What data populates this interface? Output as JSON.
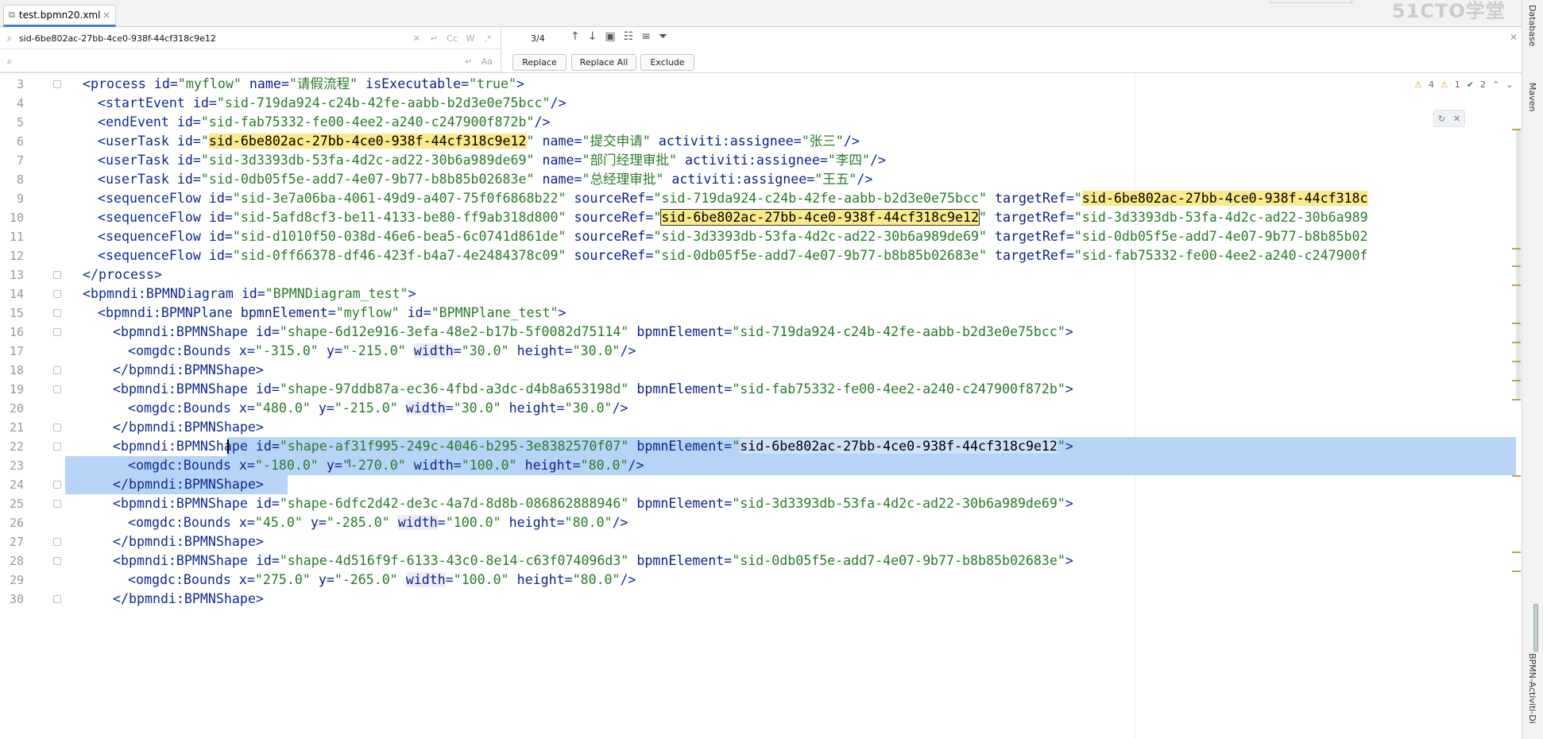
{
  "tab": {
    "icon": "xml-file-icon",
    "title": "test.bpmn20.xml",
    "close": "×"
  },
  "watermark": "51CTO学堂",
  "find": {
    "search_value": "sid-6be802ac-27bb-4ce0-938f-44cf318c9e12",
    "replace_value": "",
    "opt_case": "Cc",
    "opt_words": "W",
    "opt_regex": ".*",
    "opt_preserve": "Aa",
    "match_count": "3/4",
    "buttons": {
      "replace": "Replace",
      "replace_all": "Replace All",
      "exclude": "Exclude"
    }
  },
  "inspection": {
    "warnings": "4",
    "weak": "1",
    "typos": "2"
  },
  "side_tools": {
    "database": "Database",
    "maven": "Maven",
    "bpmn": "BPMN-Activiti-Di"
  },
  "lines": [
    {
      "n": "3",
      "indent": 1,
      "tokens": [
        [
          "tag",
          "<process "
        ],
        [
          "attr",
          "id"
        ],
        [
          "tag",
          "="
        ],
        [
          "val",
          "\"my"
        ],
        [
          "val",
          "flow\""
        ],
        [
          "tag",
          " "
        ],
        [
          "attr",
          "name"
        ],
        [
          "tag",
          "="
        ],
        [
          "val",
          "\"请假流程\""
        ],
        [
          "tag",
          " "
        ],
        [
          "attr",
          "isExecutable"
        ],
        [
          "tag",
          "="
        ],
        [
          "val",
          "\"true\""
        ],
        [
          "tag",
          ">"
        ]
      ]
    },
    {
      "n": "4",
      "indent": 2,
      "tokens": [
        [
          "tag",
          "<startEvent "
        ],
        [
          "attr",
          "id"
        ],
        [
          "tag",
          "="
        ],
        [
          "val",
          "\"sid-719da924-c24b-42fe-aabb-b2d3e0e75bcc\""
        ],
        [
          "tag",
          "/>"
        ]
      ]
    },
    {
      "n": "5",
      "indent": 2,
      "tokens": [
        [
          "tag",
          "<endEvent "
        ],
        [
          "attr",
          "id"
        ],
        [
          "tag",
          "="
        ],
        [
          "val",
          "\"sid-fab75332-fe00-4ee2-a240-c247900f872b\""
        ],
        [
          "tag",
          "/>"
        ]
      ]
    },
    {
      "n": "6",
      "indent": 2,
      "tokens": [
        [
          "tag",
          "<userTask "
        ],
        [
          "attr",
          "id"
        ],
        [
          "tag",
          "="
        ],
        [
          "val",
          "\""
        ],
        [
          "hl",
          "sid-6be802ac-27bb-4ce0-938f-44cf318c9e12"
        ],
        [
          "val",
          "\""
        ],
        [
          "tag",
          " "
        ],
        [
          "attr",
          "name"
        ],
        [
          "tag",
          "="
        ],
        [
          "val",
          "\"提交申请\""
        ],
        [
          "tag",
          " "
        ],
        [
          "attr",
          "activiti:assignee"
        ],
        [
          "tag",
          "="
        ],
        [
          "val",
          "\"张三\""
        ],
        [
          "tag",
          "/>"
        ]
      ]
    },
    {
      "n": "7",
      "indent": 2,
      "tokens": [
        [
          "tag",
          "<userTask "
        ],
        [
          "attr",
          "id"
        ],
        [
          "tag",
          "="
        ],
        [
          "val",
          "\"sid-3d3393db-53fa-4d2c-ad22-30b6a989de69\""
        ],
        [
          "tag",
          " "
        ],
        [
          "attr",
          "name"
        ],
        [
          "tag",
          "="
        ],
        [
          "val",
          "\"部门经理审批\""
        ],
        [
          "tag",
          " "
        ],
        [
          "attr",
          "activiti:assignee"
        ],
        [
          "tag",
          "="
        ],
        [
          "val",
          "\"李四\""
        ],
        [
          "tag",
          "/>"
        ]
      ]
    },
    {
      "n": "8",
      "indent": 2,
      "tokens": [
        [
          "tag",
          "<userTask "
        ],
        [
          "attr",
          "id"
        ],
        [
          "tag",
          "="
        ],
        [
          "val",
          "\"sid-0db05f5e-add7-4e07-9b77-b8b85b02683e\""
        ],
        [
          "tag",
          " "
        ],
        [
          "attr",
          "name"
        ],
        [
          "tag",
          "="
        ],
        [
          "val",
          "\"总经理审批\""
        ],
        [
          "tag",
          " "
        ],
        [
          "attr",
          "activiti:assignee"
        ],
        [
          "tag",
          "="
        ],
        [
          "val",
          "\"王五\""
        ],
        [
          "tag",
          "/>"
        ]
      ]
    },
    {
      "n": "9",
      "indent": 2,
      "tokens": [
        [
          "tag",
          "<sequenceFlow "
        ],
        [
          "attr",
          "id"
        ],
        [
          "tag",
          "="
        ],
        [
          "val",
          "\"sid-3e7a06ba-4061-49d9-a407-75f0f6868b22\""
        ],
        [
          "tag",
          " "
        ],
        [
          "attr",
          "sourceRef"
        ],
        [
          "tag",
          "="
        ],
        [
          "val",
          "\"sid-719da924-c24b-42fe-aabb-b2d3e0e75bcc\""
        ],
        [
          "tag",
          " "
        ],
        [
          "attr",
          "targetRef"
        ],
        [
          "tag",
          "="
        ],
        [
          "val",
          "\""
        ],
        [
          "hl",
          "sid-6be802ac-27bb-4ce0-938f-44cf318c"
        ]
      ]
    },
    {
      "n": "10",
      "indent": 2,
      "tokens": [
        [
          "tag",
          "<sequenceFlow "
        ],
        [
          "attr",
          "id"
        ],
        [
          "tag",
          "="
        ],
        [
          "val",
          "\"sid-5afd8cf3-be11-4133-be80-ff9ab318d800\""
        ],
        [
          "tag",
          " "
        ],
        [
          "attr",
          "sourceRef"
        ],
        [
          "tag",
          "="
        ],
        [
          "val",
          "\""
        ],
        [
          "hlc",
          "sid-6be802ac-27bb-4ce0-938f-44cf318c9e12"
        ],
        [
          "val",
          "\""
        ],
        [
          "tag",
          " "
        ],
        [
          "attr",
          "targetRef"
        ],
        [
          "tag",
          "="
        ],
        [
          "val",
          "\"sid-3d3393db-53fa-4d2c-ad22-30b6a989"
        ]
      ]
    },
    {
      "n": "11",
      "indent": 2,
      "tokens": [
        [
          "tag",
          "<sequenceFlow "
        ],
        [
          "attr",
          "id"
        ],
        [
          "tag",
          "="
        ],
        [
          "val",
          "\"sid-d1010f50-038d-46e6-bea5-6c0741d861de\""
        ],
        [
          "tag",
          " "
        ],
        [
          "attr",
          "sourceRef"
        ],
        [
          "tag",
          "="
        ],
        [
          "val",
          "\"sid-3d3393db-53fa-4d2c-ad22-30b6a989de69\""
        ],
        [
          "tag",
          " "
        ],
        [
          "attr",
          "targetRef"
        ],
        [
          "tag",
          "="
        ],
        [
          "val",
          "\"sid-0db05f5e-add7-4e07-9b77-b8b85b02"
        ]
      ]
    },
    {
      "n": "12",
      "indent": 2,
      "tokens": [
        [
          "tag",
          "<sequenceFlow "
        ],
        [
          "attr",
          "id"
        ],
        [
          "tag",
          "="
        ],
        [
          "val",
          "\"sid-0ff66378-df46-423f-b4a7-4e2484378c09\""
        ],
        [
          "tag",
          " "
        ],
        [
          "attr",
          "sourceRef"
        ],
        [
          "tag",
          "="
        ],
        [
          "val",
          "\"sid-0db05f5e-add7-4e07-9b77-b8b85b02683e\""
        ],
        [
          "tag",
          " "
        ],
        [
          "attr",
          "targetRef"
        ],
        [
          "tag",
          "="
        ],
        [
          "val",
          "\"sid-fab75332-fe00-4ee2-a240-c247900f"
        ]
      ]
    },
    {
      "n": "13",
      "indent": 1,
      "tokens": [
        [
          "tag",
          "</process>"
        ]
      ]
    },
    {
      "n": "14",
      "indent": 1,
      "tokens": [
        [
          "tag",
          "<bpmndi:BPMNDiagram "
        ],
        [
          "attr",
          "id"
        ],
        [
          "tag",
          "="
        ],
        [
          "val",
          "\"BPMNDiagram_test\""
        ],
        [
          "tag",
          ">"
        ]
      ]
    },
    {
      "n": "15",
      "indent": 2,
      "tokens": [
        [
          "tag",
          "<bpmndi:BPMNPlane "
        ],
        [
          "attr",
          "bpmnElement"
        ],
        [
          "tag",
          "="
        ],
        [
          "val",
          "\"my"
        ],
        [
          "val",
          "flow\""
        ],
        [
          "tag",
          " "
        ],
        [
          "attr",
          "id"
        ],
        [
          "tag",
          "="
        ],
        [
          "val",
          "\"BPMNPlane_test\""
        ],
        [
          "tag",
          ">"
        ]
      ]
    },
    {
      "n": "16",
      "indent": 3,
      "tokens": [
        [
          "tag",
          "<bpmndi:BPMNShape "
        ],
        [
          "attr",
          "id"
        ],
        [
          "tag",
          "="
        ],
        [
          "val",
          "\"shape-6d12e916-3efa-48e2-b17b-5f0082d75114\""
        ],
        [
          "tag",
          " "
        ],
        [
          "attr",
          "bpmnElement"
        ],
        [
          "tag",
          "="
        ],
        [
          "val",
          "\"sid-719da924-c24b-42fe-aabb-b2d3e0e75bcc\""
        ],
        [
          "tag",
          ">"
        ]
      ]
    },
    {
      "n": "17",
      "indent": 4,
      "tokens": [
        [
          "tag",
          "<omgdc:Bounds "
        ],
        [
          "attr",
          "x"
        ],
        [
          "tag",
          "="
        ],
        [
          "val",
          "\"-315.0\""
        ],
        [
          "tag",
          " "
        ],
        [
          "attr",
          "y"
        ],
        [
          "tag",
          "="
        ],
        [
          "val",
          "\"-215.0\""
        ],
        [
          "tag",
          " "
        ],
        [
          "attrw",
          "width"
        ],
        [
          "tag",
          "="
        ],
        [
          "val",
          "\"30.0\""
        ],
        [
          "tag",
          " "
        ],
        [
          "attr",
          "height"
        ],
        [
          "tag",
          "="
        ],
        [
          "val",
          "\"30.0\""
        ],
        [
          "tag",
          "/>"
        ]
      ]
    },
    {
      "n": "18",
      "indent": 3,
      "tokens": [
        [
          "tag",
          "</bpmndi:BPMNShape>"
        ]
      ]
    },
    {
      "n": "19",
      "indent": 3,
      "tokens": [
        [
          "tag",
          "<bpmndi:BPMNShape "
        ],
        [
          "attr",
          "id"
        ],
        [
          "tag",
          "="
        ],
        [
          "val",
          "\"shape-97ddb87a-ec36-4fbd-a3dc-d4b8a653198d\""
        ],
        [
          "tag",
          " "
        ],
        [
          "attr",
          "bpmnElement"
        ],
        [
          "tag",
          "="
        ],
        [
          "val",
          "\"sid-fab75332-fe00-4ee2-a240-c247900f872b\""
        ],
        [
          "tag",
          ">"
        ]
      ]
    },
    {
      "n": "20",
      "indent": 4,
      "tokens": [
        [
          "tag",
          "<omgdc:Bounds "
        ],
        [
          "attr",
          "x"
        ],
        [
          "tag",
          "="
        ],
        [
          "val",
          "\"480.0\""
        ],
        [
          "tag",
          " "
        ],
        [
          "attr",
          "y"
        ],
        [
          "tag",
          "="
        ],
        [
          "val",
          "\"-215.0\""
        ],
        [
          "tag",
          " "
        ],
        [
          "attrw",
          "width"
        ],
        [
          "tag",
          "="
        ],
        [
          "val",
          "\"30.0\""
        ],
        [
          "tag",
          " "
        ],
        [
          "attr",
          "height"
        ],
        [
          "tag",
          "="
        ],
        [
          "val",
          "\"30.0\""
        ],
        [
          "tag",
          "/>"
        ]
      ]
    },
    {
      "n": "21",
      "indent": 3,
      "tokens": [
        [
          "tag",
          "</bpmndi:BPMNShape>"
        ]
      ]
    },
    {
      "n": "22",
      "indent": 3,
      "selected": true,
      "tokens": [
        [
          "tag",
          "<bpmndi:BPMNShape "
        ],
        [
          "attr",
          "id"
        ],
        [
          "tag",
          "="
        ],
        [
          "val",
          "\"shape-af31f995-249c-4046-b295-3e8382570f07\""
        ],
        [
          "tag",
          " "
        ],
        [
          "attr",
          "bpmnElement"
        ],
        [
          "tag",
          "="
        ],
        [
          "val",
          "\""
        ],
        [
          "hlsel",
          "sid-6be802ac-27bb-4ce0-938f-44cf318c9e12"
        ],
        [
          "val",
          "\""
        ],
        [
          "tag",
          ">"
        ]
      ]
    },
    {
      "n": "23",
      "indent": 4,
      "selected": true,
      "tokens": [
        [
          "tag",
          "<omgdc:Bounds "
        ],
        [
          "attr",
          "x"
        ],
        [
          "tag",
          "="
        ],
        [
          "val",
          "\"-180.0\""
        ],
        [
          "tag",
          " "
        ],
        [
          "attr",
          "y"
        ],
        [
          "tag",
          "="
        ],
        [
          "val",
          "\"-270.0\""
        ],
        [
          "tag",
          " "
        ],
        [
          "attr",
          "width"
        ],
        [
          "tag",
          "="
        ],
        [
          "val",
          "\"100.0\""
        ],
        [
          "tag",
          " "
        ],
        [
          "attr",
          "height"
        ],
        [
          "tag",
          "="
        ],
        [
          "val",
          "\"80.0\""
        ],
        [
          "tag",
          "/>"
        ]
      ]
    },
    {
      "n": "24",
      "indent": 3,
      "selected_partial": true,
      "tokens": [
        [
          "tag",
          "</bpmndi:BPMNShape>"
        ]
      ]
    },
    {
      "n": "25",
      "indent": 3,
      "tokens": [
        [
          "tag",
          "<bpmndi:BPMNShape "
        ],
        [
          "attr",
          "id"
        ],
        [
          "tag",
          "="
        ],
        [
          "val",
          "\"shape-6dfc2d42-de3c-4a7d-8d8b-086862888946\""
        ],
        [
          "tag",
          " "
        ],
        [
          "attr",
          "bpmnElement"
        ],
        [
          "tag",
          "="
        ],
        [
          "val",
          "\"sid-3d3393db-53fa-4d2c-ad22-30b6a989de69\""
        ],
        [
          "tag",
          ">"
        ]
      ]
    },
    {
      "n": "26",
      "indent": 4,
      "tokens": [
        [
          "tag",
          "<omgdc:Bounds "
        ],
        [
          "attr",
          "x"
        ],
        [
          "tag",
          "="
        ],
        [
          "val",
          "\"45.0\""
        ],
        [
          "tag",
          " "
        ],
        [
          "attr",
          "y"
        ],
        [
          "tag",
          "="
        ],
        [
          "val",
          "\"-285.0\""
        ],
        [
          "tag",
          " "
        ],
        [
          "attrw",
          "width"
        ],
        [
          "tag",
          "="
        ],
        [
          "val",
          "\"100.0\""
        ],
        [
          "tag",
          " "
        ],
        [
          "attr",
          "height"
        ],
        [
          "tag",
          "="
        ],
        [
          "val",
          "\"80.0\""
        ],
        [
          "tag",
          "/>"
        ]
      ]
    },
    {
      "n": "27",
      "indent": 3,
      "tokens": [
        [
          "tag",
          "</bpmndi:BPMNShape>"
        ]
      ]
    },
    {
      "n": "28",
      "indent": 3,
      "tokens": [
        [
          "tag",
          "<bpmndi:BPMNShape "
        ],
        [
          "attr",
          "id"
        ],
        [
          "tag",
          "="
        ],
        [
          "val",
          "\"shape-4d516f9f-6133-43c0-8e14-c63f074096d3\""
        ],
        [
          "tag",
          " "
        ],
        [
          "attr",
          "bpmnElement"
        ],
        [
          "tag",
          "="
        ],
        [
          "val",
          "\"sid-0db05f5e-add7-4e07-9b77-b8b85b02683e\""
        ],
        [
          "tag",
          ">"
        ]
      ]
    },
    {
      "n": "29",
      "indent": 4,
      "tokens": [
        [
          "tag",
          "<omgdc:Bounds "
        ],
        [
          "attr",
          "x"
        ],
        [
          "tag",
          "="
        ],
        [
          "val",
          "\"275.0\""
        ],
        [
          "tag",
          " "
        ],
        [
          "attr",
          "y"
        ],
        [
          "tag",
          "="
        ],
        [
          "val",
          "\"-265.0\""
        ],
        [
          "tag",
          " "
        ],
        [
          "attrw",
          "width"
        ],
        [
          "tag",
          "="
        ],
        [
          "val",
          "\"100.0\""
        ],
        [
          "tag",
          " "
        ],
        [
          "attr",
          "height"
        ],
        [
          "tag",
          "="
        ],
        [
          "val",
          "\"80.0\""
        ],
        [
          "tag",
          "/>"
        ]
      ]
    },
    {
      "n": "30",
      "indent": 3,
      "tokens": [
        [
          "tag",
          "</bpmndi:BPMNShape>"
        ]
      ]
    }
  ]
}
